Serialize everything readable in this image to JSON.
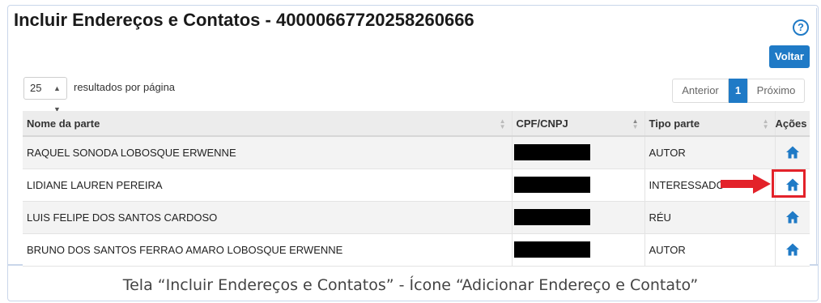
{
  "page": {
    "title": "Incluir Endereços e Contatos - 40000667720258260666",
    "help_glyph": "?",
    "back_button": "Voltar"
  },
  "pagination": {
    "page_size": "25",
    "page_size_label": "resultados por página",
    "prev_label": "Anterior",
    "current_page": "1",
    "next_label": "Próximo"
  },
  "table": {
    "headers": [
      "Nome da parte",
      "CPF/CNPJ",
      "Tipo parte",
      "Ações"
    ],
    "rows": [
      {
        "nome": "RAQUEL SONODA LOBOSQUE ERWENNE",
        "tipo": "AUTOR",
        "action_icon": "home-icon"
      },
      {
        "nome": "LIDIANE LAUREN PEREIRA",
        "tipo": "INTERESSADO",
        "action_icon": "home-icon"
      },
      {
        "nome": "LUIS FELIPE DOS SANTOS CARDOSO",
        "tipo": "RÉU",
        "action_icon": "home-icon"
      },
      {
        "nome": "BRUNO DOS SANTOS FERRAO AMARO LOBOSQUE ERWENNE",
        "tipo": "AUTOR",
        "action_icon": "home-icon"
      }
    ]
  },
  "caption": "Tela “Incluir Endereços e Contatos” - Ícone “Adicionar Endereço e Contato”",
  "colors": {
    "accent": "#1f7ac6",
    "highlight": "#e3222a"
  }
}
